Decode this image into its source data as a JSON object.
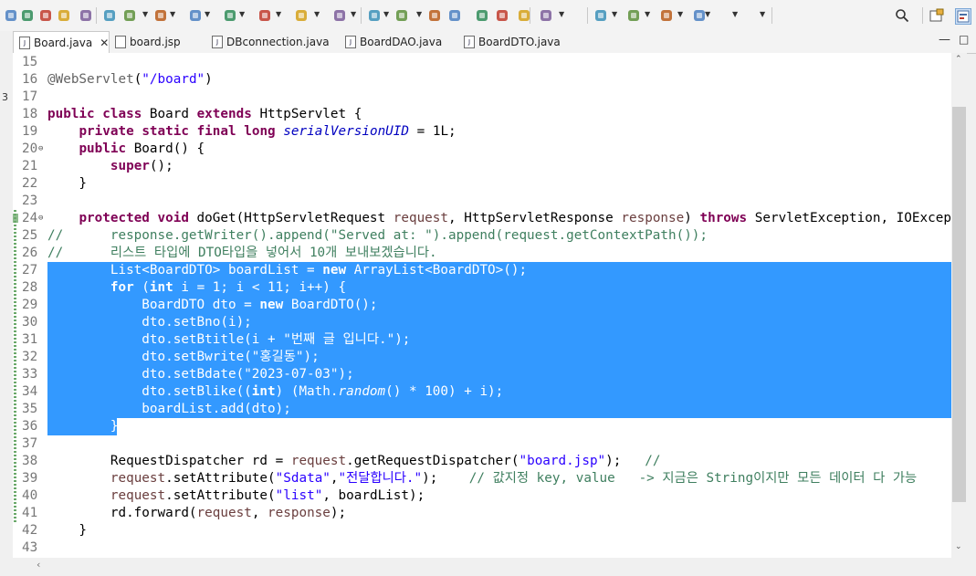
{
  "toolbar": {
    "icons": [
      "save-icon",
      "undo-icon",
      "redo-icon",
      "skip-icon",
      "refactor-icon",
      "build-icon",
      "debug-icon",
      "run-icon",
      "run-coverage-icon",
      "external-tools-icon",
      "new-class-icon",
      "new-package-icon",
      "open-type-icon",
      "open-task-icon",
      "next-annotation-icon",
      "highlight-icon",
      "toggle-block-icon",
      "show-whitespace-icon",
      "globe-icon",
      "search-icon-tb",
      "next-edit-icon",
      "prev-edit-icon",
      "back-icon",
      "forward-icon",
      "pin-icon"
    ],
    "search_icon": "search-icon",
    "perspective_icon": "open-perspective-icon"
  },
  "tabs": [
    {
      "label": "Board.java",
      "active": true,
      "type": "java"
    },
    {
      "label": "board.jsp",
      "active": false,
      "type": "jsp"
    },
    {
      "label": "DBconnection.java",
      "active": false,
      "type": "java"
    },
    {
      "label": "BoardDAO.java",
      "active": false,
      "type": "java"
    },
    {
      "label": "BoardDTO.java",
      "active": false,
      "type": "java"
    }
  ],
  "editor": {
    "lines": [
      {
        "n": "15",
        "t": ""
      },
      {
        "n": "16",
        "t": "@WebServlet(\"/board\")"
      },
      {
        "n": "17",
        "t": ""
      },
      {
        "n": "18",
        "t": "public class Board extends HttpServlet {"
      },
      {
        "n": "19",
        "t": "    private static final long serialVersionUID = 1L;"
      },
      {
        "n": "20",
        "t": "    public Board() {"
      },
      {
        "n": "21",
        "t": "        super();"
      },
      {
        "n": "22",
        "t": "    }"
      },
      {
        "n": "23",
        "t": ""
      },
      {
        "n": "24",
        "t": "    protected void doGet(HttpServletRequest request, HttpServletResponse response) throws ServletException, IOException {"
      },
      {
        "n": "25",
        "t": "//      response.getWriter().append(\"Served at: \").append(request.getContextPath());"
      },
      {
        "n": "26",
        "t": "//      리스트 타입에 DTO타입을 넣어서 10개 보내보겠습니다."
      },
      {
        "n": "27",
        "t": "        List<BoardDTO> boardList = new ArrayList<BoardDTO>();"
      },
      {
        "n": "28",
        "t": "        for (int i = 1; i < 11; i++) {"
      },
      {
        "n": "29",
        "t": "            BoardDTO dto = new BoardDTO();"
      },
      {
        "n": "30",
        "t": "            dto.setBno(i);"
      },
      {
        "n": "31",
        "t": "            dto.setBtitle(i + \"번째 글 입니다.\");"
      },
      {
        "n": "32",
        "t": "            dto.setBwrite(\"홍길동\");"
      },
      {
        "n": "33",
        "t": "            dto.setBdate(\"2023-07-03\");"
      },
      {
        "n": "34",
        "t": "            dto.setBlike((int) (Math.random() * 100) + i);"
      },
      {
        "n": "35",
        "t": "            boardList.add(dto);"
      },
      {
        "n": "36",
        "t": "        }"
      },
      {
        "n": "37",
        "t": ""
      },
      {
        "n": "38",
        "t": "        RequestDispatcher rd = request.getRequestDispatcher(\"board.jsp\");   //"
      },
      {
        "n": "39",
        "t": "        request.setAttribute(\"Sdata\",\"전달합니다.\");    // 값지정 key, value   -> 지금은 String이지만 모든 데이터 다 가능"
      },
      {
        "n": "40",
        "t": "        request.setAttribute(\"list\", boardList);"
      },
      {
        "n": "41",
        "t": "        rd.forward(request, response);"
      },
      {
        "n": "42",
        "t": "    }"
      },
      {
        "n": "43",
        "t": ""
      }
    ],
    "selected_from": "27",
    "selected_to": "36"
  },
  "left_strip_char": "3",
  "colors": {
    "selection": "#3399ff",
    "keyword": "#7f0055",
    "string": "#2a00ff",
    "comment": "#3f7f5f",
    "field": "#0000c0"
  }
}
